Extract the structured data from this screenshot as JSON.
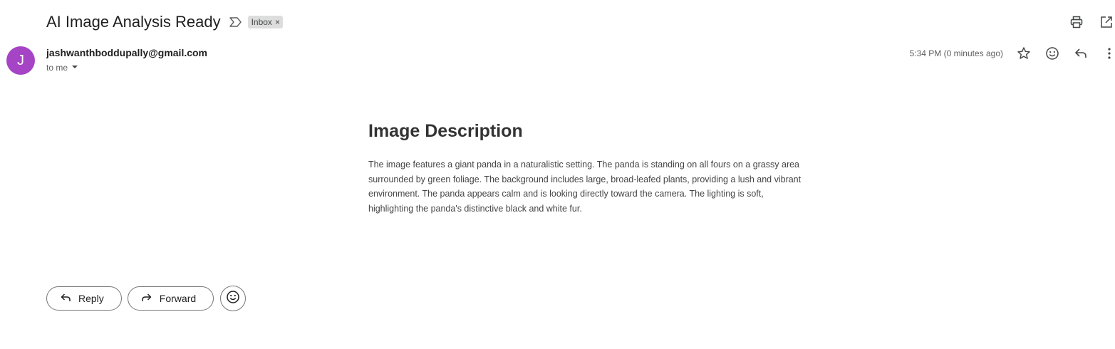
{
  "email": {
    "subject": "AI Image Analysis Ready",
    "label": "Inbox",
    "label_remove_icon": "×",
    "sender_initial": "J",
    "sender_email": "jashwanthboddupally@gmail.com",
    "recipient_text": "to me",
    "timestamp": "5:34 PM (0 minutes ago)"
  },
  "body": {
    "heading": "Image Description",
    "paragraph": "The image features a giant panda in a naturalistic setting. The panda is standing on all fours on a grassy area surrounded by green foliage. The background includes large, broad-leafed plants, providing a lush and vibrant environment. The panda appears calm and is looking directly toward the camera. The lighting is soft, highlighting the panda's distinctive black and white fur."
  },
  "actions": {
    "reply_label": "Reply",
    "forward_label": "Forward"
  },
  "icons": {
    "important": "important-marker-icon",
    "print": "print-icon",
    "new_window": "open-in-new-window-icon",
    "star": "star-icon",
    "emoji": "emoji-icon",
    "reply": "reply-icon",
    "more": "more-vert-icon",
    "dropdown": "chevron-down-icon",
    "forward": "forward-icon"
  },
  "colors": {
    "avatar_bg": "#a544c4",
    "label_chip_bg": "#dddddd",
    "button_border": "#747775"
  }
}
